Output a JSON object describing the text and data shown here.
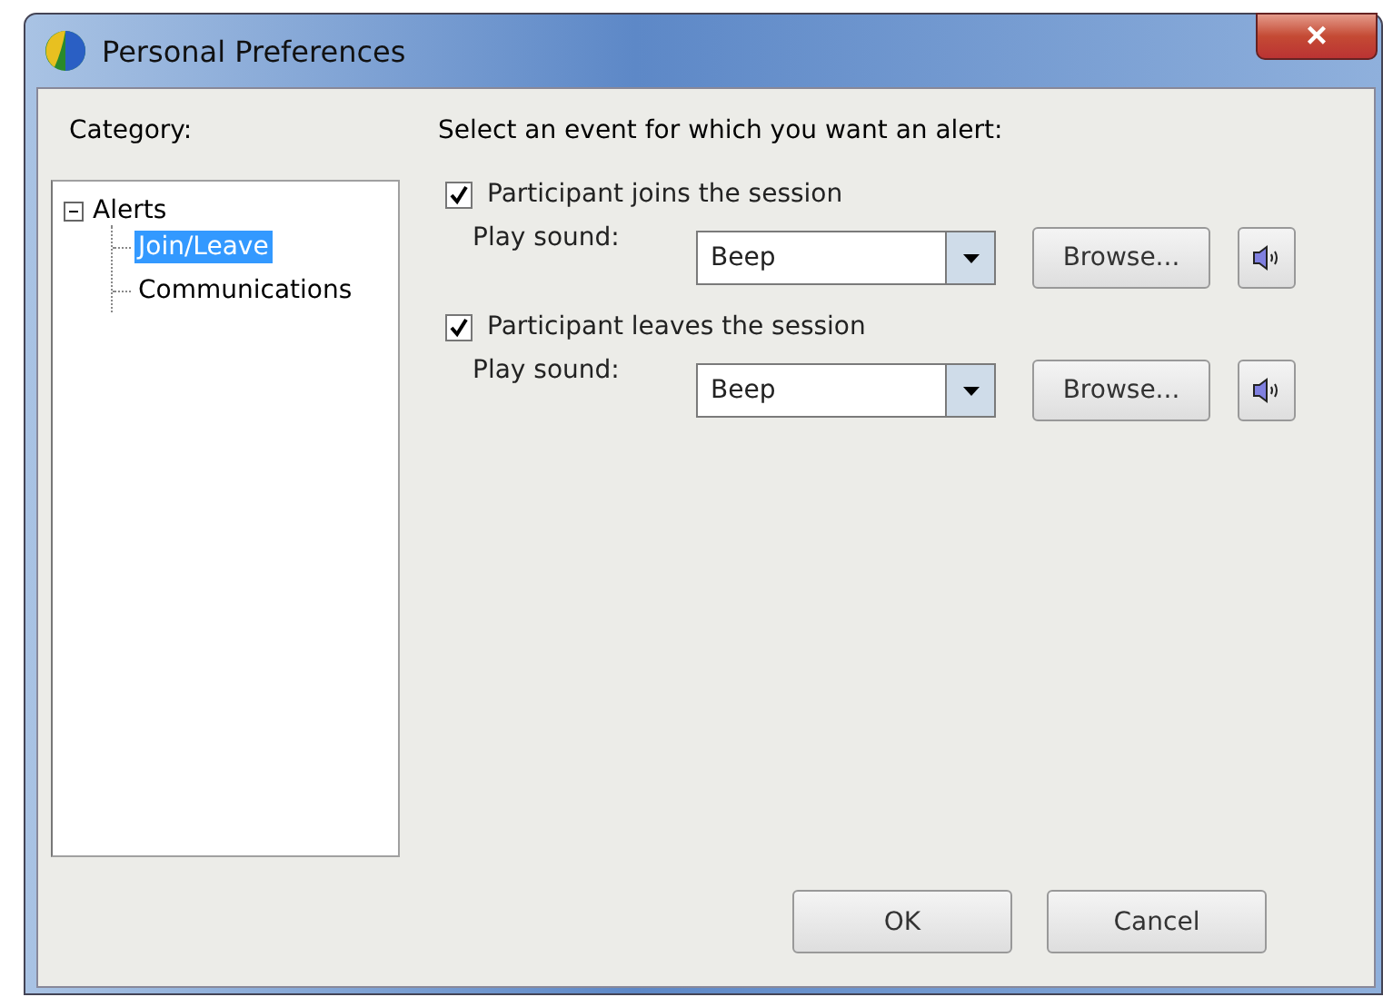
{
  "window": {
    "title": "Personal Preferences",
    "close": "×"
  },
  "category_label": "Category:",
  "tree": [
    {
      "label": "Alerts",
      "expanded": true,
      "selected": false,
      "children": [
        {
          "label": "Join/Leave",
          "selected": true
        },
        {
          "label": "Communications",
          "selected": false
        }
      ]
    }
  ],
  "prompt": "Select an event for which you want an alert:",
  "events": [
    {
      "label": "Participant joins the session",
      "checked": true,
      "sound_label": "Play sound:",
      "sound": "Beep",
      "browse": "Browse..."
    },
    {
      "label": "Participant leaves the session",
      "checked": true,
      "sound_label": "Play sound:",
      "sound": "Beep",
      "browse": "Browse..."
    }
  ],
  "buttons": [
    "OK",
    "Cancel"
  ]
}
